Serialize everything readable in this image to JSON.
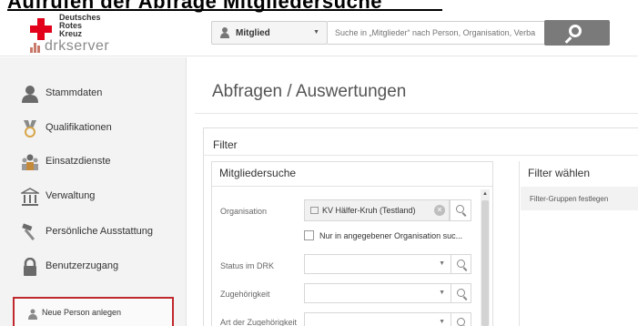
{
  "top_heading": "Aufrufen der Abfrage Mitgliedersuche",
  "header": {
    "org_lines": [
      "Deutsches",
      "Rotes",
      "Kreuz"
    ],
    "brand": "drkserver",
    "scope_select": "Mitglied",
    "search_placeholder": "Suche in „Mitglieder“ nach Person, Organisation, Verba",
    "colors": {
      "red_cross": "#e2001a",
      "search_button": "#7a7a7a"
    }
  },
  "sidebar": {
    "items": [
      {
        "label": "Stammdaten",
        "icon": "person-icon"
      },
      {
        "label": "Qualifikationen",
        "icon": "medal-icon"
      },
      {
        "label": "Einsatzdienste",
        "icon": "team-icon"
      },
      {
        "label": "Verwaltung",
        "icon": "building-icon"
      },
      {
        "label": "Persönliche Ausstattung",
        "icon": "hammer-icon"
      },
      {
        "label": "Benutzerzugang",
        "icon": "lock-icon"
      }
    ],
    "new_person": "Neue Person anlegen",
    "highlight_color": "#c0282d"
  },
  "main": {
    "title": "Abfragen / Auswertungen",
    "filter_title": "Filter",
    "search_box_title": "Mitgliedersuche",
    "fields": {
      "organisation_label": "Organisation",
      "organisation_value": "KV Hälfer-Kruh (Testland)",
      "only_org_label": "Nur in angegebener Organisation suc...",
      "status_label": "Status im DRK",
      "zugehoerigkeit_label": "Zugehörigkeit",
      "art_label": "Art der Zugehörigkeit"
    },
    "chooser_title": "Filter wählen",
    "chooser_item": "Filter-Gruppen festlegen"
  }
}
